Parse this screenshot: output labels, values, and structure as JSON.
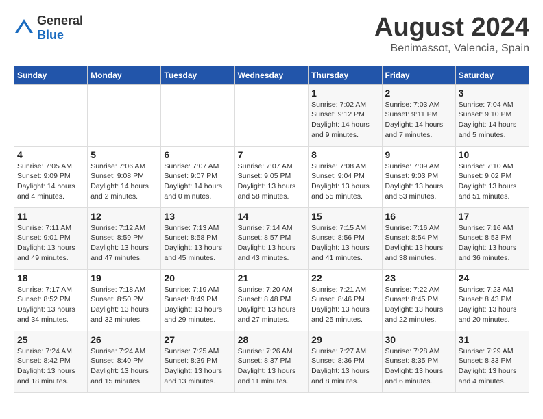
{
  "logo": {
    "general": "General",
    "blue": "Blue"
  },
  "title": "August 2024",
  "subtitle": "Benimassot, Valencia, Spain",
  "days_of_week": [
    "Sunday",
    "Monday",
    "Tuesday",
    "Wednesday",
    "Thursday",
    "Friday",
    "Saturday"
  ],
  "weeks": [
    [
      {
        "num": "",
        "info": ""
      },
      {
        "num": "",
        "info": ""
      },
      {
        "num": "",
        "info": ""
      },
      {
        "num": "",
        "info": ""
      },
      {
        "num": "1",
        "info": "Sunrise: 7:02 AM\nSunset: 9:12 PM\nDaylight: 14 hours\nand 9 minutes."
      },
      {
        "num": "2",
        "info": "Sunrise: 7:03 AM\nSunset: 9:11 PM\nDaylight: 14 hours\nand 7 minutes."
      },
      {
        "num": "3",
        "info": "Sunrise: 7:04 AM\nSunset: 9:10 PM\nDaylight: 14 hours\nand 5 minutes."
      }
    ],
    [
      {
        "num": "4",
        "info": "Sunrise: 7:05 AM\nSunset: 9:09 PM\nDaylight: 14 hours\nand 4 minutes."
      },
      {
        "num": "5",
        "info": "Sunrise: 7:06 AM\nSunset: 9:08 PM\nDaylight: 14 hours\nand 2 minutes."
      },
      {
        "num": "6",
        "info": "Sunrise: 7:07 AM\nSunset: 9:07 PM\nDaylight: 14 hours\nand 0 minutes."
      },
      {
        "num": "7",
        "info": "Sunrise: 7:07 AM\nSunset: 9:05 PM\nDaylight: 13 hours\nand 58 minutes."
      },
      {
        "num": "8",
        "info": "Sunrise: 7:08 AM\nSunset: 9:04 PM\nDaylight: 13 hours\nand 55 minutes."
      },
      {
        "num": "9",
        "info": "Sunrise: 7:09 AM\nSunset: 9:03 PM\nDaylight: 13 hours\nand 53 minutes."
      },
      {
        "num": "10",
        "info": "Sunrise: 7:10 AM\nSunset: 9:02 PM\nDaylight: 13 hours\nand 51 minutes."
      }
    ],
    [
      {
        "num": "11",
        "info": "Sunrise: 7:11 AM\nSunset: 9:01 PM\nDaylight: 13 hours\nand 49 minutes."
      },
      {
        "num": "12",
        "info": "Sunrise: 7:12 AM\nSunset: 8:59 PM\nDaylight: 13 hours\nand 47 minutes."
      },
      {
        "num": "13",
        "info": "Sunrise: 7:13 AM\nSunset: 8:58 PM\nDaylight: 13 hours\nand 45 minutes."
      },
      {
        "num": "14",
        "info": "Sunrise: 7:14 AM\nSunset: 8:57 PM\nDaylight: 13 hours\nand 43 minutes."
      },
      {
        "num": "15",
        "info": "Sunrise: 7:15 AM\nSunset: 8:56 PM\nDaylight: 13 hours\nand 41 minutes."
      },
      {
        "num": "16",
        "info": "Sunrise: 7:16 AM\nSunset: 8:54 PM\nDaylight: 13 hours\nand 38 minutes."
      },
      {
        "num": "17",
        "info": "Sunrise: 7:16 AM\nSunset: 8:53 PM\nDaylight: 13 hours\nand 36 minutes."
      }
    ],
    [
      {
        "num": "18",
        "info": "Sunrise: 7:17 AM\nSunset: 8:52 PM\nDaylight: 13 hours\nand 34 minutes."
      },
      {
        "num": "19",
        "info": "Sunrise: 7:18 AM\nSunset: 8:50 PM\nDaylight: 13 hours\nand 32 minutes."
      },
      {
        "num": "20",
        "info": "Sunrise: 7:19 AM\nSunset: 8:49 PM\nDaylight: 13 hours\nand 29 minutes."
      },
      {
        "num": "21",
        "info": "Sunrise: 7:20 AM\nSunset: 8:48 PM\nDaylight: 13 hours\nand 27 minutes."
      },
      {
        "num": "22",
        "info": "Sunrise: 7:21 AM\nSunset: 8:46 PM\nDaylight: 13 hours\nand 25 minutes."
      },
      {
        "num": "23",
        "info": "Sunrise: 7:22 AM\nSunset: 8:45 PM\nDaylight: 13 hours\nand 22 minutes."
      },
      {
        "num": "24",
        "info": "Sunrise: 7:23 AM\nSunset: 8:43 PM\nDaylight: 13 hours\nand 20 minutes."
      }
    ],
    [
      {
        "num": "25",
        "info": "Sunrise: 7:24 AM\nSunset: 8:42 PM\nDaylight: 13 hours\nand 18 minutes."
      },
      {
        "num": "26",
        "info": "Sunrise: 7:24 AM\nSunset: 8:40 PM\nDaylight: 13 hours\nand 15 minutes."
      },
      {
        "num": "27",
        "info": "Sunrise: 7:25 AM\nSunset: 8:39 PM\nDaylight: 13 hours\nand 13 minutes."
      },
      {
        "num": "28",
        "info": "Sunrise: 7:26 AM\nSunset: 8:37 PM\nDaylight: 13 hours\nand 11 minutes."
      },
      {
        "num": "29",
        "info": "Sunrise: 7:27 AM\nSunset: 8:36 PM\nDaylight: 13 hours\nand 8 minutes."
      },
      {
        "num": "30",
        "info": "Sunrise: 7:28 AM\nSunset: 8:35 PM\nDaylight: 13 hours\nand 6 minutes."
      },
      {
        "num": "31",
        "info": "Sunrise: 7:29 AM\nSunset: 8:33 PM\nDaylight: 13 hours\nand 4 minutes."
      }
    ]
  ]
}
